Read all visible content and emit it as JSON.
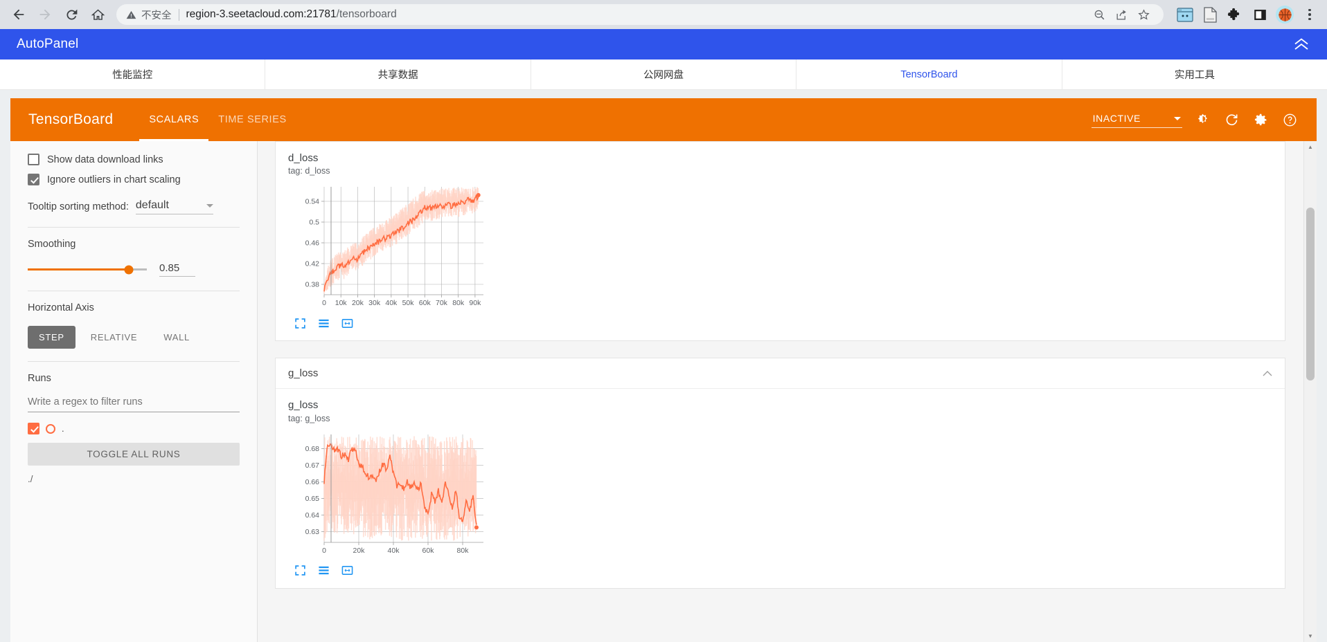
{
  "browser": {
    "back_icon": "arrow-left-icon",
    "forward_icon": "arrow-right-icon",
    "reload_icon": "reload-icon",
    "home_icon": "home-icon",
    "security_label": "不安全",
    "url_main": "region-3.seetacloud.com:21781",
    "url_path": "/tensorboard",
    "zoom_out_icon": "zoom-out-icon",
    "share_icon": "share-icon",
    "bookmark_icon": "star-icon",
    "extensions": [
      "window-capture-icon",
      "document-icon",
      "puzzle-piece-icon",
      "side-panel-icon",
      "basketball-avatar-icon",
      "three-dot-menu-icon"
    ]
  },
  "autopanel": {
    "title": "AutoPanel",
    "collapse_icon": "double-chevron-up-icon",
    "tabs": [
      {
        "label": "性能监控",
        "active": false
      },
      {
        "label": "共享数据",
        "active": false
      },
      {
        "label": "公网网盘",
        "active": false
      },
      {
        "label": "TensorBoard",
        "active": true
      },
      {
        "label": "实用工具",
        "active": false
      }
    ]
  },
  "tensorboard": {
    "logo": "TensorBoard",
    "accent_color": "#ef7101",
    "tabs": [
      {
        "label": "SCALARS",
        "active": true
      },
      {
        "label": "TIME SERIES",
        "active": false
      }
    ],
    "reload_state": "INACTIVE",
    "header_icons": [
      "brightness-icon",
      "refresh-icon",
      "settings-gear-icon",
      "help-question-icon"
    ]
  },
  "sidebar": {
    "show_download_links": {
      "label": "Show data download links",
      "checked": false
    },
    "ignore_outliers": {
      "label": "Ignore outliers in chart scaling",
      "checked": true
    },
    "tooltip_sorting": {
      "label": "Tooltip sorting method:",
      "value": "default"
    },
    "smoothing": {
      "label": "Smoothing",
      "value": "0.85",
      "percent": 85
    },
    "horizontal_axis": {
      "label": "Horizontal Axis",
      "options": [
        {
          "label": "STEP",
          "active": true
        },
        {
          "label": "RELATIVE",
          "active": false
        },
        {
          "label": "WALL",
          "active": false
        }
      ]
    },
    "runs": {
      "label": "Runs",
      "filter_placeholder": "Write a regex to filter runs",
      "run_items": [
        {
          "label": ".",
          "checked": true,
          "color": "#ff6d42"
        }
      ],
      "toggle_all_label": "TOGGLE ALL RUNS",
      "run_path": "./"
    }
  },
  "charts": [
    {
      "section_title": "d_loss",
      "collapsed": false,
      "title": "d_loss",
      "tag": "tag: d_loss",
      "actions": [
        "expand-chart-icon",
        "data-table-icon",
        "fit-domain-icon"
      ]
    },
    {
      "section_title": "g_loss",
      "collapsed": false,
      "title": "g_loss",
      "tag": "tag: g_loss",
      "actions": [
        "expand-chart-icon",
        "data-table-icon",
        "fit-domain-icon"
      ]
    }
  ],
  "chart_data": [
    {
      "type": "line",
      "title": "d_loss",
      "tag": "d_loss",
      "xlabel": "",
      "ylabel": "",
      "xlim": [
        0,
        95000
      ],
      "ylim": [
        0.36,
        0.568
      ],
      "grid": true,
      "legend": "none",
      "series_color": "#ff6d42",
      "band_color": "#ffd4c6",
      "xticks": [
        0,
        10000,
        20000,
        30000,
        40000,
        50000,
        60000,
        70000,
        80000,
        90000
      ],
      "xticklabels": [
        "0",
        "10k",
        "20k",
        "30k",
        "40k",
        "50k",
        "60k",
        "70k",
        "80k",
        "90k"
      ],
      "yticks": [
        0.38,
        0.42,
        0.46,
        0.5,
        0.54
      ],
      "yticklabels": [
        "0.38",
        "0.42",
        "0.46",
        "0.5",
        "0.54"
      ],
      "x": [
        0,
        2000,
        4000,
        6000,
        8000,
        10000,
        12000,
        14000,
        16000,
        18000,
        20000,
        22000,
        24000,
        26000,
        28000,
        30000,
        32000,
        34000,
        36000,
        38000,
        40000,
        42000,
        44000,
        46000,
        48000,
        50000,
        52000,
        54000,
        56000,
        58000,
        60000,
        62000,
        64000,
        66000,
        68000,
        70000,
        72000,
        74000,
        76000,
        78000,
        80000,
        82000,
        84000,
        86000,
        88000,
        90000,
        92000
      ],
      "values": [
        0.372,
        0.389,
        0.401,
        0.408,
        0.412,
        0.419,
        0.415,
        0.423,
        0.427,
        0.431,
        0.428,
        0.436,
        0.443,
        0.449,
        0.452,
        0.458,
        0.461,
        0.466,
        0.468,
        0.472,
        0.475,
        0.479,
        0.483,
        0.487,
        0.492,
        0.497,
        0.502,
        0.508,
        0.514,
        0.521,
        0.527,
        0.529,
        0.526,
        0.531,
        0.528,
        0.532,
        0.529,
        0.534,
        0.531,
        0.536,
        0.533,
        0.538,
        0.535,
        0.548,
        0.539,
        0.544,
        0.552
      ],
      "band_lower": [
        0.362,
        0.368,
        0.374,
        0.381,
        0.386,
        0.392,
        0.389,
        0.398,
        0.402,
        0.408,
        0.404,
        0.412,
        0.419,
        0.424,
        0.428,
        0.433,
        0.437,
        0.441,
        0.444,
        0.448,
        0.451,
        0.455,
        0.459,
        0.463,
        0.468,
        0.473,
        0.478,
        0.484,
        0.489,
        0.496,
        0.502,
        0.504,
        0.501,
        0.506,
        0.503,
        0.508,
        0.505,
        0.509,
        0.507,
        0.511,
        0.509,
        0.513,
        0.511,
        0.521,
        0.515,
        0.519,
        0.528
      ],
      "band_upper": [
        0.382,
        0.412,
        0.428,
        0.436,
        0.441,
        0.448,
        0.444,
        0.452,
        0.457,
        0.462,
        0.458,
        0.468,
        0.475,
        0.481,
        0.485,
        0.491,
        0.495,
        0.499,
        0.503,
        0.507,
        0.511,
        0.516,
        0.521,
        0.526,
        0.531,
        0.537,
        0.542,
        0.548,
        0.553,
        0.559,
        0.564,
        0.566,
        0.563,
        0.567,
        0.564,
        0.567,
        0.565,
        0.568,
        0.566,
        0.568,
        0.566,
        0.568,
        0.566,
        0.568,
        0.567,
        0.568,
        0.568
      ]
    },
    {
      "type": "line",
      "title": "g_loss",
      "tag": "g_loss",
      "xlabel": "",
      "ylabel": "",
      "xlim": [
        0,
        92000
      ],
      "ylim": [
        0.6235,
        0.6885
      ],
      "grid": true,
      "legend": "none",
      "series_color": "#ff6d42",
      "band_color": "#ffd4c6",
      "xticks": [
        0,
        20000,
        40000,
        60000,
        80000
      ],
      "xticklabels": [
        "0",
        "20k",
        "40k",
        "60k",
        "80k"
      ],
      "yticks": [
        0.63,
        0.64,
        0.65,
        0.66,
        0.67,
        0.68
      ],
      "yticklabels": [
        "0.63",
        "0.64",
        "0.65",
        "0.66",
        "0.67",
        "0.68"
      ],
      "x": [
        0,
        2000,
        4000,
        6000,
        8000,
        10000,
        12000,
        14000,
        16000,
        18000,
        20000,
        22000,
        24000,
        26000,
        28000,
        30000,
        32000,
        34000,
        36000,
        38000,
        40000,
        42000,
        44000,
        46000,
        48000,
        50000,
        52000,
        54000,
        56000,
        58000,
        60000,
        62000,
        64000,
        66000,
        68000,
        70000,
        72000,
        74000,
        76000,
        78000,
        80000,
        82000,
        84000,
        86000,
        88000
      ],
      "values": [
        0.6605,
        0.6835,
        0.6815,
        0.6785,
        0.6795,
        0.6755,
        0.6765,
        0.6735,
        0.6795,
        0.6785,
        0.6715,
        0.6685,
        0.6655,
        0.6625,
        0.6645,
        0.6615,
        0.6665,
        0.6705,
        0.6675,
        0.6745,
        0.6655,
        0.6575,
        0.6595,
        0.6555,
        0.6605,
        0.6565,
        0.6605,
        0.6545,
        0.6595,
        0.6455,
        0.6395,
        0.6525,
        0.6485,
        0.6545,
        0.6465,
        0.6595,
        0.6515,
        0.6435,
        0.6555,
        0.6395,
        0.6355,
        0.6485,
        0.6425,
        0.6515,
        0.6325
      ],
      "band_lower": [
        0.6245,
        0.6285,
        0.6295,
        0.6275,
        0.6285,
        0.6265,
        0.6275,
        0.6255,
        0.6285,
        0.6275,
        0.6255,
        0.6245,
        0.6245,
        0.6245,
        0.6245,
        0.6245,
        0.6245,
        0.6255,
        0.6245,
        0.6265,
        0.6245,
        0.6245,
        0.6245,
        0.6245,
        0.6245,
        0.6245,
        0.6245,
        0.6245,
        0.6245,
        0.6245,
        0.6245,
        0.6245,
        0.6245,
        0.6245,
        0.6245,
        0.6245,
        0.6245,
        0.6245,
        0.6245,
        0.6245,
        0.6245,
        0.6245,
        0.6245,
        0.6245,
        0.6245
      ],
      "band_upper": [
        0.6875,
        0.6875,
        0.6875,
        0.6875,
        0.6875,
        0.6875,
        0.6875,
        0.6875,
        0.6875,
        0.6875,
        0.6875,
        0.6875,
        0.6875,
        0.6875,
        0.6875,
        0.6875,
        0.6875,
        0.6875,
        0.6875,
        0.6875,
        0.6875,
        0.6875,
        0.6875,
        0.6875,
        0.6875,
        0.6875,
        0.6875,
        0.6875,
        0.6875,
        0.6875,
        0.6875,
        0.6875,
        0.6875,
        0.6875,
        0.6875,
        0.6875,
        0.6875,
        0.6875,
        0.6875,
        0.6875,
        0.6875,
        0.6875,
        0.6875,
        0.6875,
        0.6875
      ]
    }
  ]
}
